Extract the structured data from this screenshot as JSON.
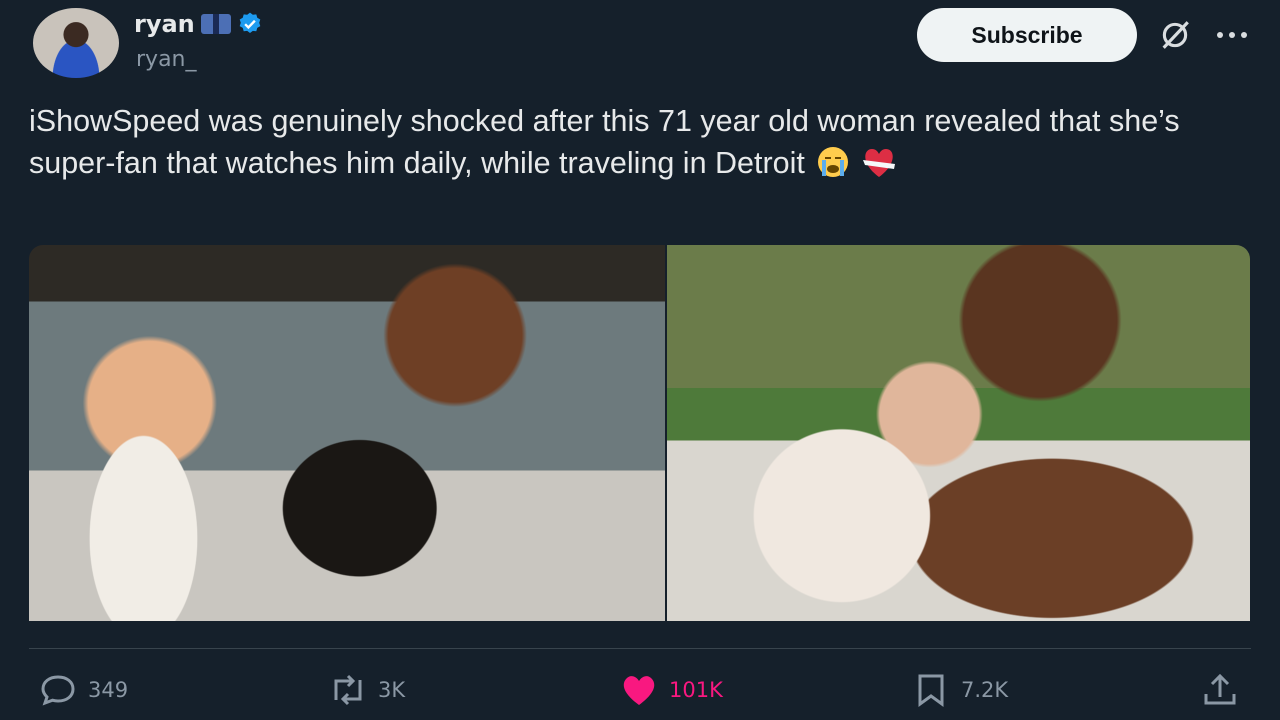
{
  "author": {
    "display_name": "ryan",
    "handle": "ryan_"
  },
  "header": {
    "subscribe_label": "Subscribe"
  },
  "tweet": {
    "text": "iShowSpeed was genuinely shocked after this 71 year old woman revealed that she’s super-fan that watches him daily, while traveling in Detroit",
    "emojis": [
      "loudly-crying-face-icon",
      "mending-heart-icon"
    ]
  },
  "media": [
    "photo-left",
    "photo-right"
  ],
  "actions": {
    "replies": "349",
    "reposts": "3K",
    "likes": "101K",
    "bookmarks": "7.2K"
  },
  "colors": {
    "background": "#15202b",
    "text": "#e7e9ea",
    "muted": "#8b98a5",
    "like": "#f91880",
    "verified": "#1d9bf0"
  }
}
